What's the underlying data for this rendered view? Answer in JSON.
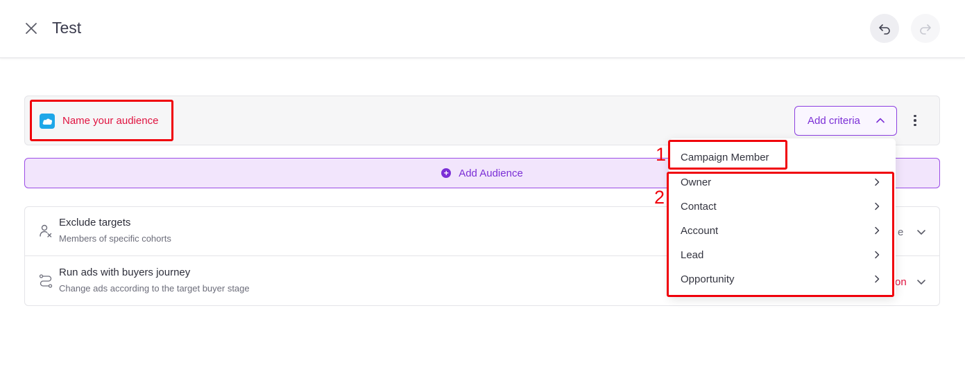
{
  "header": {
    "title": "Test",
    "close_icon": "close-icon",
    "undo_icon": "undo-icon",
    "redo_icon": "redo-icon"
  },
  "audience": {
    "name_placeholder": "Name your audience",
    "source_icon": "salesforce-icon",
    "add_criteria_label": "Add criteria",
    "add_audience_label": "Add Audience"
  },
  "settings": {
    "rows": [
      {
        "title": "Exclude targets",
        "subtitle": "Members of specific cohorts",
        "value": "e",
        "icon": "user-exclude-icon"
      },
      {
        "title": "Run ads with buyers journey",
        "subtitle": "Change ads according to the target buyer stage",
        "value": "on",
        "icon": "journey-icon"
      }
    ]
  },
  "dropdown": {
    "items": [
      {
        "label": "Campaign Member",
        "has_submenu": false
      },
      {
        "label": "Owner",
        "has_submenu": true
      },
      {
        "label": "Contact",
        "has_submenu": true
      },
      {
        "label": "Account",
        "has_submenu": true
      },
      {
        "label": "Lead",
        "has_submenu": true
      },
      {
        "label": "Opportunity",
        "has_submenu": true
      }
    ]
  },
  "annotations": {
    "one": "1",
    "two": "2"
  },
  "colors": {
    "accent_purple": "#7b2fd6",
    "alert_red": "#e0123f",
    "annotation_red": "#f0000a",
    "salesforce_blue": "#1ea7e8"
  }
}
